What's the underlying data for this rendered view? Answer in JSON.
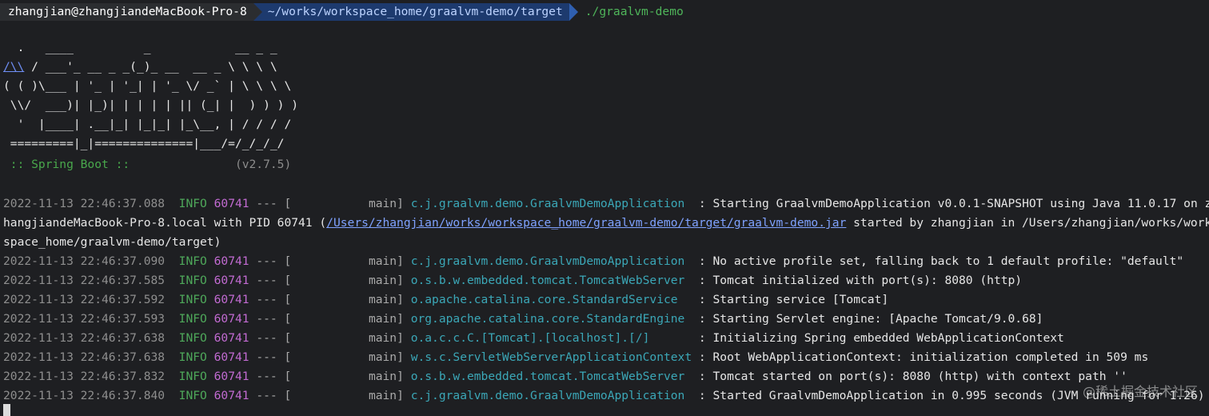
{
  "prompt": {
    "user_host": "zhangjian@zhangjiandeMacBook-Pro-8",
    "cwd": "~/works/workspace_home/graalvm-demo/target",
    "command": "./graalvm-demo"
  },
  "banner": {
    "line1": "  .   ____          _            __ _ _",
    "line2_link": "/\\\\",
    "line2_rest": " / ___'_ __ _ _(_)_ __  __ _ \\ \\ \\ \\",
    "line3": "( ( )\\___ | '_ | '_| | '_ \\/ _` | \\ \\ \\ \\",
    "line4": " \\\\/  ___)| |_)| | | | | || (_| |  ) ) ) )",
    "line5": "  '  |____| .__|_| |_|_| |_\\__, | / / / /",
    "line6": " =========|_|==============|___/=/_/_/_/",
    "spring_label": " :: Spring Boot ::",
    "spring_version": "(v2.7.5)"
  },
  "log": {
    "first": {
      "timestamp": "2022-11-13 22:46:37.088",
      "level": "INFO",
      "pid": "60741",
      "sep": "--- [",
      "thread": "           main]",
      "logger": "c.j.graalvm.demo.GraalvmDemoApplication ",
      "message_part1": " : Starting GraalvmDemoApplication v0.0.1-SNAPSHOT using Java 11.0.17 on z",
      "message_part2": "hangjiandeMacBook-Pro-8.local with PID 60741 (",
      "jar_path": "/Users/zhangjian/works/workspace_home/graalvm-demo/target/graalvm-demo.jar",
      "message_part3": " started by zhangjian in /Users/zhangjian/works/work",
      "message_part4": "space_home/graalvm-demo/target)"
    },
    "entries": [
      {
        "timestamp": "2022-11-13 22:46:37.090",
        "level": "INFO",
        "pid": "60741",
        "sep": "--- [",
        "thread": "           main]",
        "logger": "c.j.graalvm.demo.GraalvmDemoApplication ",
        "message": " : No active profile set, falling back to 1 default profile: \"default\""
      },
      {
        "timestamp": "2022-11-13 22:46:37.585",
        "level": "INFO",
        "pid": "60741",
        "sep": "--- [",
        "thread": "           main]",
        "logger": "o.s.b.w.embedded.tomcat.TomcatWebServer ",
        "message": " : Tomcat initialized with port(s): 8080 (http)"
      },
      {
        "timestamp": "2022-11-13 22:46:37.592",
        "level": "INFO",
        "pid": "60741",
        "sep": "--- [",
        "thread": "           main]",
        "logger": "o.apache.catalina.core.StandardService  ",
        "message": " : Starting service [Tomcat]"
      },
      {
        "timestamp": "2022-11-13 22:46:37.593",
        "level": "INFO",
        "pid": "60741",
        "sep": "--- [",
        "thread": "           main]",
        "logger": "org.apache.catalina.core.StandardEngine ",
        "message": " : Starting Servlet engine: [Apache Tomcat/9.0.68]"
      },
      {
        "timestamp": "2022-11-13 22:46:37.638",
        "level": "INFO",
        "pid": "60741",
        "sep": "--- [",
        "thread": "           main]",
        "logger": "o.a.c.c.C.[Tomcat].[localhost].[/]      ",
        "message": " : Initializing Spring embedded WebApplicationContext"
      },
      {
        "timestamp": "2022-11-13 22:46:37.638",
        "level": "INFO",
        "pid": "60741",
        "sep": "--- [",
        "thread": "           main]",
        "logger": "w.s.c.ServletWebServerApplicationContext",
        "message": " : Root WebApplicationContext: initialization completed in 509 ms"
      },
      {
        "timestamp": "2022-11-13 22:46:37.832",
        "level": "INFO",
        "pid": "60741",
        "sep": "--- [",
        "thread": "           main]",
        "logger": "o.s.b.w.embedded.tomcat.TomcatWebServer ",
        "message": " : Tomcat started on port(s): 8080 (http) with context path ''"
      },
      {
        "timestamp": "2022-11-13 22:46:37.840",
        "level": "INFO",
        "pid": "60741",
        "sep": "--- [",
        "thread": "           main]",
        "logger": "c.j.graalvm.demo.GraalvmDemoApplication ",
        "message": " : Started GraalvmDemoApplication in 0.995 seconds (JVM running for 1.26)"
      }
    ]
  },
  "watermark": "@稀土掘金技术社区"
}
